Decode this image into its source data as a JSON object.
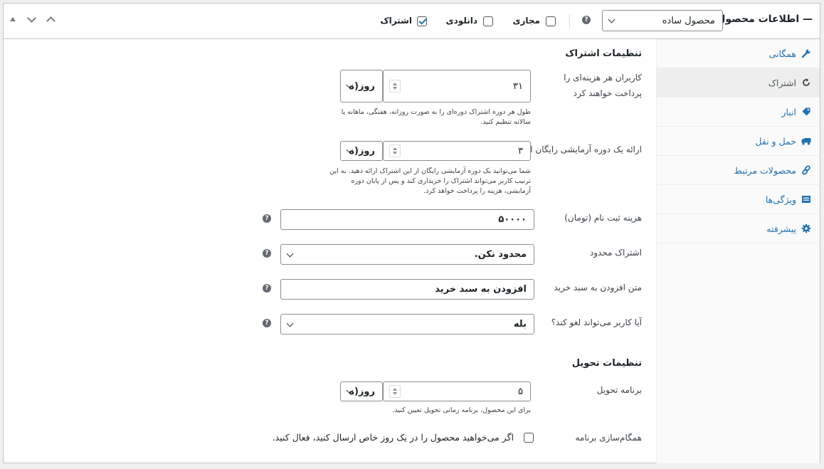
{
  "header": {
    "title": "اطلاعات محصول —",
    "product_type": "محصول ساده",
    "help_glyph": "?",
    "checkboxes": [
      {
        "label": "مجازی",
        "checked": false
      },
      {
        "label": "دانلودی",
        "checked": false
      },
      {
        "label": "اشتراک",
        "checked": true
      }
    ]
  },
  "tabs": [
    {
      "label": "همگانی",
      "icon": "wrench-icon",
      "active": false
    },
    {
      "label": "اشتراک",
      "icon": "refresh-icon",
      "active": true
    },
    {
      "label": "انبار",
      "icon": "tag-icon",
      "active": false
    },
    {
      "label": "حمل و نقل",
      "icon": "truck-icon",
      "active": false
    },
    {
      "label": "محصولات مرتبط",
      "icon": "link-icon",
      "active": false
    },
    {
      "label": "ویژگی‌ها",
      "icon": "list-icon",
      "active": false
    },
    {
      "label": "پیشرفته",
      "icon": "gear-icon",
      "active": false
    }
  ],
  "subscription": {
    "section_title": "تنظیمات اشتراک",
    "billing": {
      "label": "کاربران هر هزینه‌ای را پرداخت خواهند کرد",
      "value": "۳۱",
      "unit": "روز(ه",
      "desc": "طول هر دوره اشتراک دوره‌ای را به صورت روزانه، هفتگی، ماهانه یا سالانه تنظیم کنید."
    },
    "trial": {
      "label": "ارائه یک دوره آزمایشی رایگان از",
      "value": "۳",
      "unit": "روز(ه",
      "desc": "شما می‌توانید یک دوره آزمایشی رایگان از این اشتراک ارائه دهید. به این ترتیب کاربر می‌تواند اشتراک را خریداری کند و پس از پایان دوره آزمایشی، هزینه را پرداخت خواهد کرد."
    },
    "signup_fee": {
      "label": "هزینه ثبت نام (تومان)",
      "value": "۵۰۰۰۰"
    },
    "limit": {
      "label": "اشتراک محدود",
      "value": "محدود نکن."
    },
    "cart_text": {
      "label": "متن افزودن به سبد خرید",
      "value": "افزودن به سبد خرید"
    },
    "cancel": {
      "label": "آیا کاربر می‌تواند لغو کند؟",
      "value": "بله"
    }
  },
  "delivery": {
    "section_title": "تنظیمات تحویل",
    "schedule": {
      "label": "برنامه تحویل",
      "value": "۵",
      "unit": "روز(ه",
      "desc": "برای این محصول، برنامه زمانی تحویل تعیین کنید."
    },
    "sync": {
      "label": "همگام‌سازی برنامه",
      "checkbox_label": "اگر می‌خواهید محصول را در یک روز خاص ارسال کنید، فعال کنید.",
      "checked": false
    }
  }
}
